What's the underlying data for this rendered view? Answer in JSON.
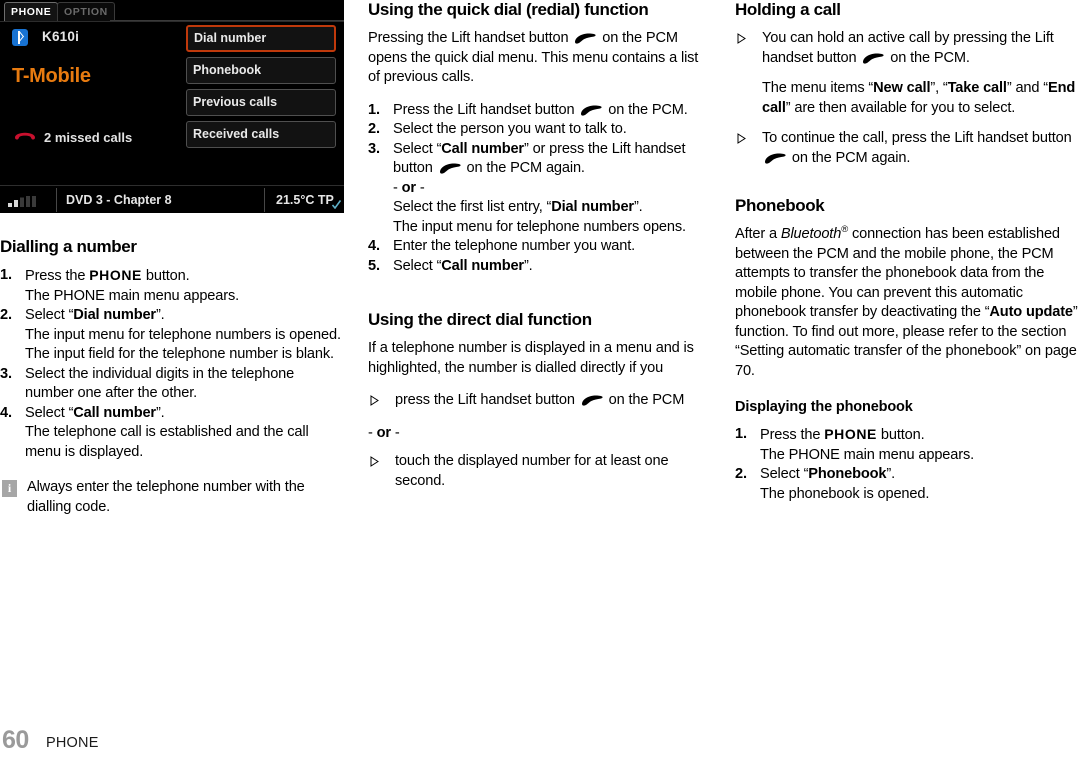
{
  "screenshot": {
    "tabs": [
      {
        "label": "PHONE",
        "active": true
      },
      {
        "label": "OPTION",
        "active": false
      }
    ],
    "device_name": "K610i",
    "carrier": "T-Mobile",
    "missed_calls": "2 missed calls",
    "menu_items": [
      {
        "label": "Dial number",
        "selected": true
      },
      {
        "label": "Phonebook",
        "selected": false
      },
      {
        "label": "Previous calls",
        "selected": false
      },
      {
        "label": "Received calls",
        "selected": false
      }
    ],
    "status_bar": {
      "track": "DVD 3 - Chapter 8",
      "temperature": "21.5°C TP"
    },
    "icons": {
      "bluetooth": "bluetooth-icon",
      "missed_call": "missed-call-handset-icon",
      "signal": "signal-strength-icon",
      "tp_check": "tp-checkmark-icon"
    },
    "colors": {
      "selection_border": "#c0390b",
      "carrier_text": "#e87b10",
      "bluetooth_blue": "#1873d3",
      "missed_call_red": "#c8102e"
    }
  },
  "col1": {
    "heading": "Dialling a number",
    "steps": [
      {
        "num": "1.",
        "lead_before": "Press the ",
        "button": "PHONE",
        "lead_after": " button.",
        "sub": "The PHONE main menu appears."
      },
      {
        "num": "2.",
        "lead_before": "Select “",
        "bold": "Dial number",
        "lead_after": "”.",
        "sub": "The input menu for telephone numbers is opened. The input field for the telephone number is blank."
      },
      {
        "num": "3.",
        "lead_before": "Select the individual digits in the telephone number one after the other.",
        "bold": "",
        "lead_after": "",
        "sub": ""
      },
      {
        "num": "4.",
        "lead_before": "Select “",
        "bold": "Call number",
        "lead_after": "”.",
        "sub": "The telephone call is established and the call menu is displayed."
      }
    ],
    "note": "Always enter the telephone number with the dialling code."
  },
  "col2": {
    "quickdial": {
      "heading": "Using the quick dial (redial) function",
      "intro_a": "Pressing the Lift handset button",
      "intro_b": "on the PCM opens the quick dial menu. This menu contains a list of previous calls.",
      "step1_a": "Press the Lift handset button",
      "step1_b": "on the PCM.",
      "step2": "Select the person you want to talk to.",
      "step3_a": "Select “",
      "step3_bold": "Call number",
      "step3_b": "” or press the Lift handset button",
      "step3_c": "on the PCM again.",
      "step3_or": "- or -",
      "step3_d_a": "Select the first list entry, “",
      "step3_d_bold": "Dial number",
      "step3_d_b": "”.",
      "step3_e": "The input menu for telephone numbers opens.",
      "step4": "Enter the telephone number you want.",
      "step5_a": "Select “",
      "step5_bold": "Call number",
      "step5_b": "”."
    },
    "directdial": {
      "heading": "Using the direct dial function",
      "intro": "If a telephone number is displayed in a menu and is highlighted, the number is dialled directly if you",
      "bullet1_a": "press the Lift handset button",
      "bullet1_b": "on the PCM",
      "or": "- or -",
      "bullet2": "touch the displayed number for at least one second."
    }
  },
  "col3": {
    "holding": {
      "heading": "Holding a call",
      "bullet1_a": "You can hold an active call by pressing the Lift handset button",
      "bullet1_b": "on the PCM.",
      "note_a": "The menu items “",
      "note_bold1": "New call",
      "note_b": "”, “",
      "note_bold2": "Take call",
      "note_c": "” and “",
      "note_bold3": "End call",
      "note_d": "” are then available for you to select.",
      "bullet2_a": "To continue the call, press the Lift handset button",
      "bullet2_b": "on the PCM again."
    },
    "phonebook": {
      "heading": "Phonebook",
      "para_a": "After a ",
      "para_italic": "Bluetooth",
      "para_sup": "®",
      "para_b": " connection has been established between the PCM and the mobile phone, the PCM attempts to transfer the phonebook data from the mobile phone. You can prevent this automatic phonebook transfer by deactivating the “",
      "para_bold": "Auto update",
      "para_c": "” function. To find out more, please refer to the section “Setting automatic transfer of the phonebook” on page 70."
    },
    "displaying": {
      "heading": "Displaying the phonebook",
      "step1_a": "Press the ",
      "step1_button": "PHONE",
      "step1_b": " button.",
      "step1_sub": "The PHONE main menu appears.",
      "step2_a": "Select “",
      "step2_bold": "Phonebook",
      "step2_b": "”.",
      "step2_sub": "The phonebook is opened."
    }
  },
  "footer": {
    "page_number": "60",
    "chapter": "PHONE"
  }
}
